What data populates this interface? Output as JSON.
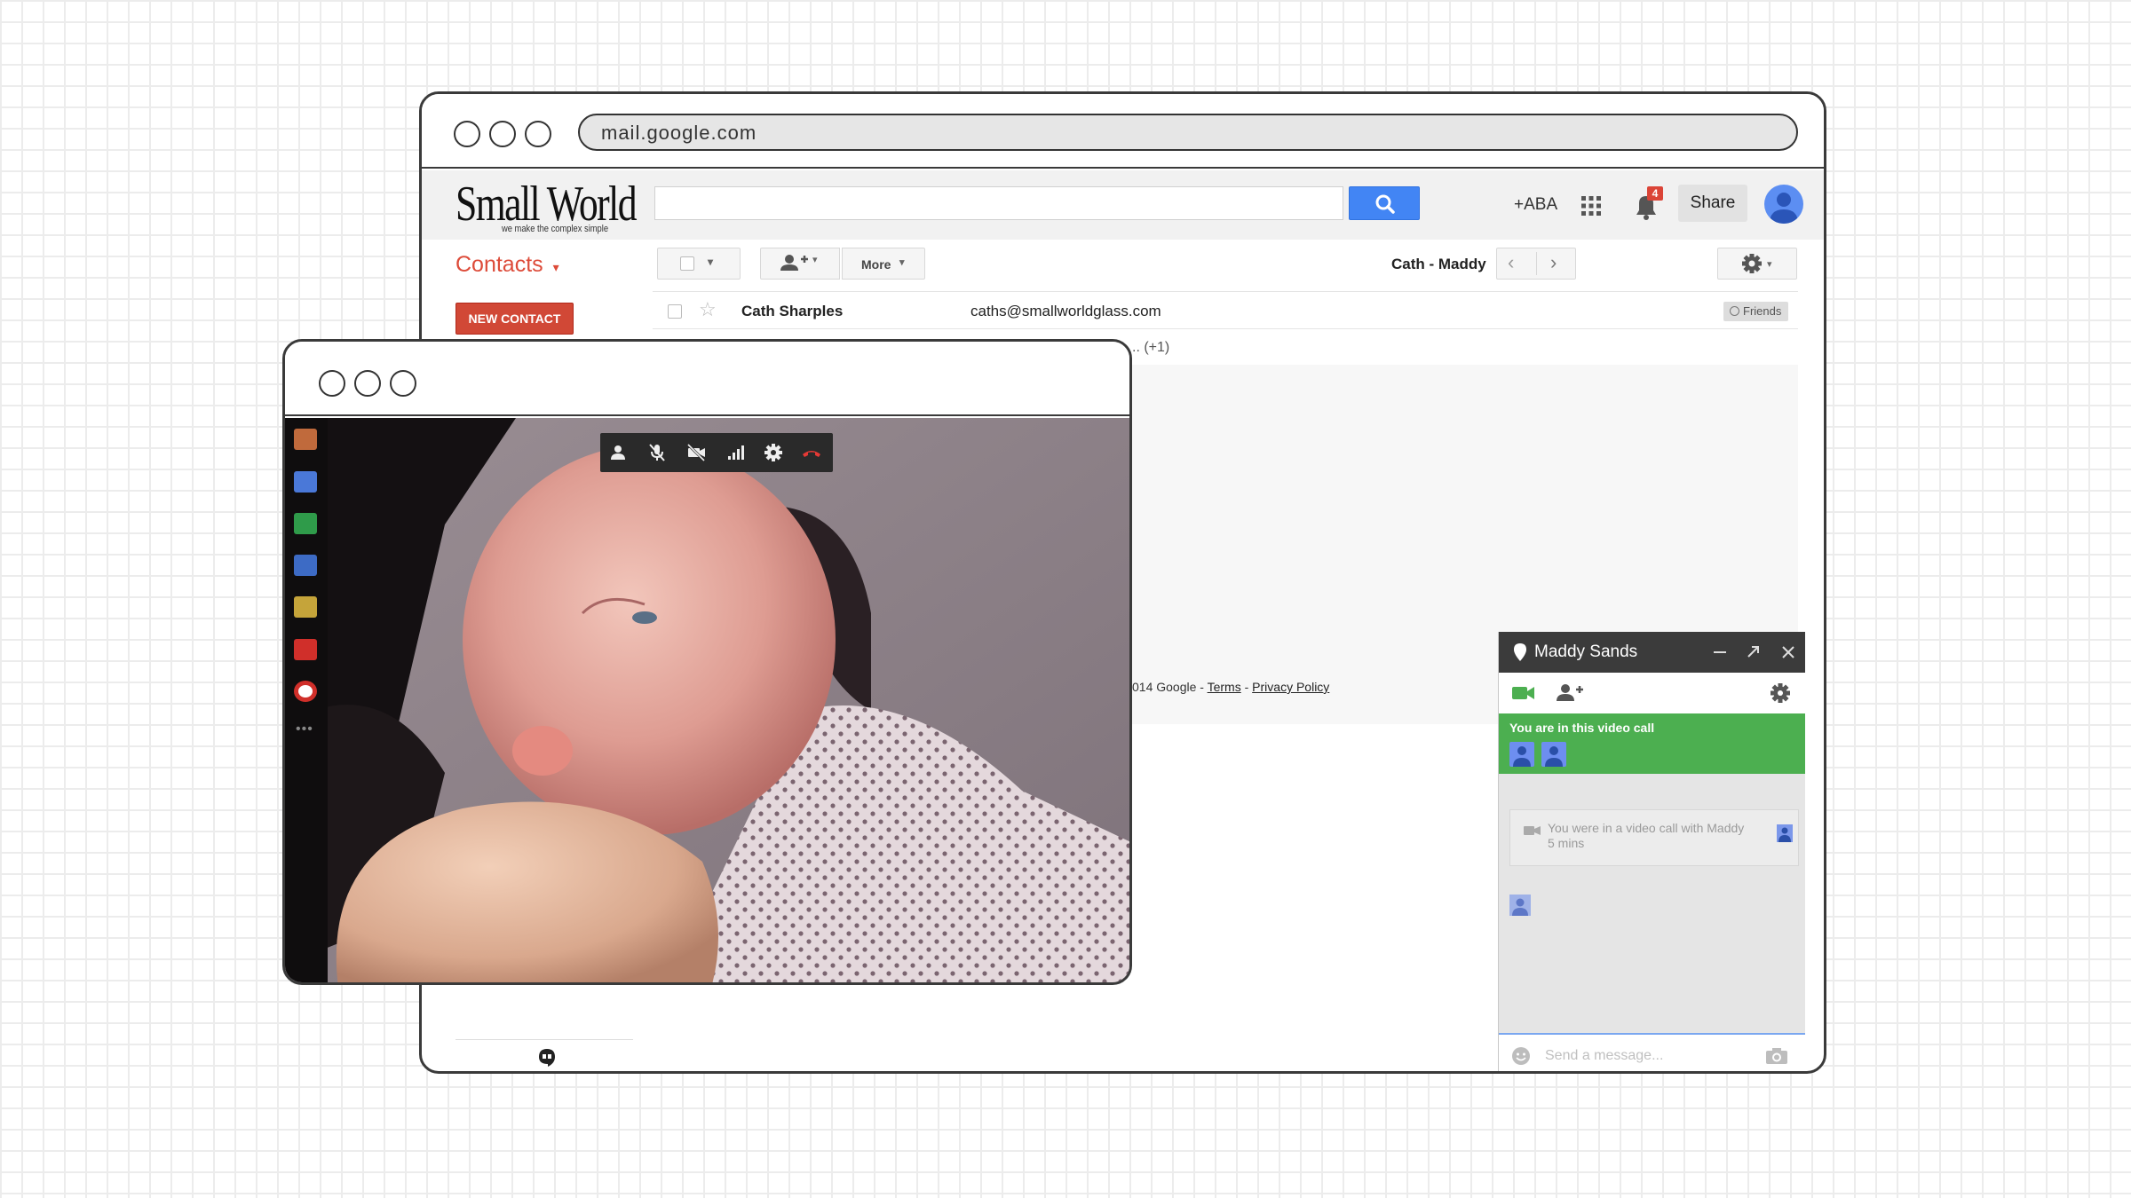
{
  "browser": {
    "url": "mail.google.com"
  },
  "brand": {
    "logo": "Small World",
    "tagline": "we make the complex simple"
  },
  "header": {
    "plus_name": "+ABA",
    "notification_count": "4",
    "share_label": "Share",
    "icons": [
      "search-icon",
      "apps-grid-icon",
      "bell-icon",
      "avatar-icon"
    ]
  },
  "contacts": {
    "title": "Contacts",
    "more_label": "More",
    "group_label": "Cath - Maddy",
    "new_contact_label": "NEW CONTACT",
    "rows": [
      {
        "name": "Cath Sharples",
        "email": "caths@smallworldglass.com",
        "tag": "Friends"
      }
    ],
    "extra_row_suffix": "..  (+1)"
  },
  "footer": {
    "copyright": "014 Google - ",
    "terms": "Terms",
    "sep": " - ",
    "privacy": "Privacy Policy"
  },
  "chat": {
    "contact_name": "Maddy Sands",
    "in_call_text": "You are in this video call",
    "history_line1": "You were in a video call with Maddy",
    "history_line2": "5 mins",
    "input_placeholder": "Send a message...",
    "colors": {
      "header": "#3b3b3b",
      "call_banner": "#4caf50",
      "accent": "#4caf50"
    }
  },
  "video_call": {
    "toolbar_icons": [
      "add-person-icon",
      "mic-off-icon",
      "camera-off-icon",
      "signal-icon",
      "gear-icon",
      "hang-up-icon"
    ],
    "rail_icons": [
      "app-icon",
      "chat-icon",
      "share-screen-icon",
      "camera-icon",
      "photos-icon",
      "youtube-icon",
      "help-icon",
      "more-icon"
    ]
  }
}
